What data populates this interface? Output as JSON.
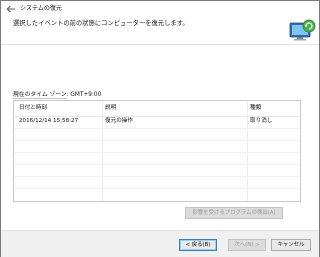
{
  "window": {
    "title": "システムの復元"
  },
  "header": {
    "instruction": "選択したイベントの前の状態にコンピューターを復元します。"
  },
  "timezone": {
    "label": "現在のタイム ゾーン: GMT+9:00"
  },
  "table": {
    "columns": [
      "日付と時刻",
      "説明",
      "種類"
    ],
    "rows": [
      {
        "datetime": "2016/12/14 15:58:27",
        "description": "復元の操作",
        "type": "取り消し"
      }
    ]
  },
  "buttons": {
    "scan": "影響を受けるプログラムの検出(A)",
    "back": "< 戻る(B)",
    "next": "次へ(N) >",
    "cancel": "キャンセル"
  },
  "icons": {
    "back": "back-arrow-icon",
    "hero": "system-restore-icon"
  }
}
